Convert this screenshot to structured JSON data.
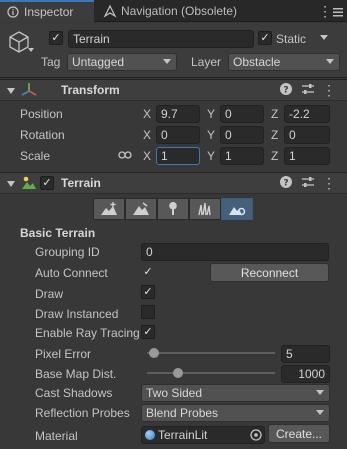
{
  "tabs": {
    "inspector": "Inspector",
    "navigation": "Navigation (Obsolete)"
  },
  "gameobject": {
    "name": "Terrain",
    "active": true,
    "static_label": "Static",
    "static": true,
    "tag_label": "Tag",
    "tag_value": "Untagged",
    "layer_label": "Layer",
    "layer_value": "Obstacle"
  },
  "transform": {
    "title": "Transform",
    "position_label": "Position",
    "rotation_label": "Rotation",
    "scale_label": "Scale",
    "axis_x": "X",
    "axis_y": "Y",
    "axis_z": "Z",
    "position": {
      "x": "9.7",
      "y": "0",
      "z": "-2.2"
    },
    "rotation": {
      "x": "0",
      "y": "0",
      "z": "0"
    },
    "scale": {
      "x": "1",
      "y": "1",
      "z": "1"
    }
  },
  "terrain": {
    "title": "Terrain",
    "enabled": true,
    "toolbar_selected": 4,
    "basic_section": "Basic Terrain",
    "grouping_id_label": "Grouping ID",
    "grouping_id": "0",
    "auto_connect_label": "Auto Connect",
    "auto_connect": true,
    "reconnect_label": "Reconnect",
    "draw_label": "Draw",
    "draw": true,
    "draw_instanced_label": "Draw Instanced",
    "draw_instanced": false,
    "ray_tracing_label": "Enable Ray Tracing",
    "ray_tracing": true,
    "pixel_error_label": "Pixel Error",
    "pixel_error": "5",
    "pixel_error_fraction": 0.02,
    "base_map_label": "Base Map Dist.",
    "base_map_dist": "1000",
    "base_map_fraction": 0.22,
    "cast_shadows_label": "Cast Shadows",
    "cast_shadows": "Two Sided",
    "reflection_label": "Reflection Probes",
    "reflection": "Blend Probes",
    "material_label": "Material",
    "material": "TerrainLit",
    "create_label": "Create..."
  },
  "colors": {
    "accent": "#3a79bb",
    "panel": "#383838",
    "header": "#3e3e3e"
  }
}
